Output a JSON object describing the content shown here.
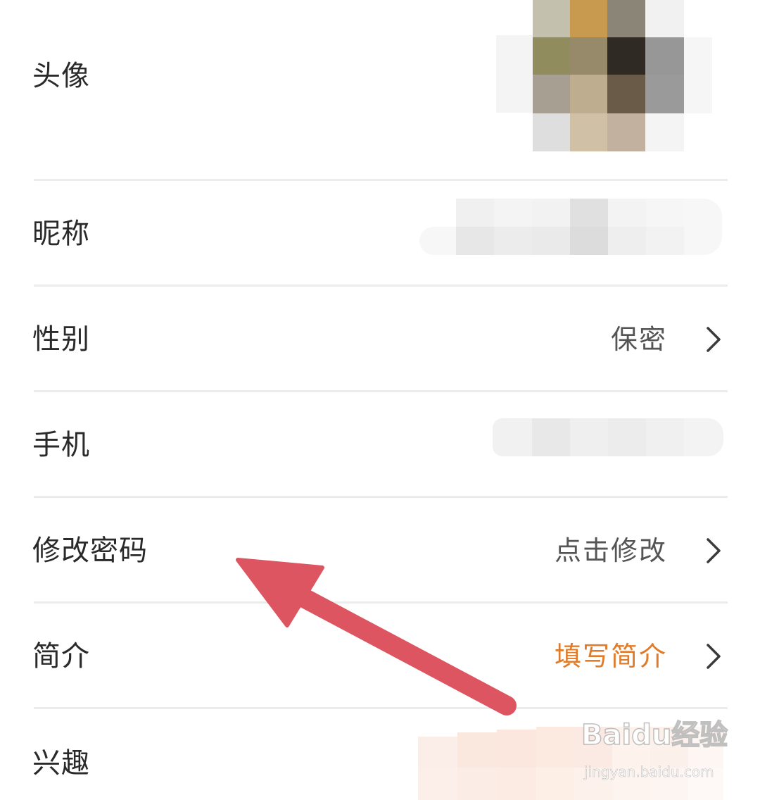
{
  "rows": [
    {
      "label": "头像"
    },
    {
      "label": "昵称"
    },
    {
      "label": "性别",
      "value": "保密"
    },
    {
      "label": "手机"
    },
    {
      "label": "修改密码",
      "value": "点击修改"
    },
    {
      "label": "简介",
      "value": "填写简介"
    },
    {
      "label": "兴趣"
    }
  ],
  "watermark": {
    "logo": "Baidu经验",
    "url": "jingyan.baidu.com"
  },
  "colors": {
    "accent_value": "#e07b2a",
    "arrow": "#dc5560",
    "divider": "#ececec"
  },
  "icons": [
    "chevron-right-icon",
    "red-arrow-annotation"
  ]
}
